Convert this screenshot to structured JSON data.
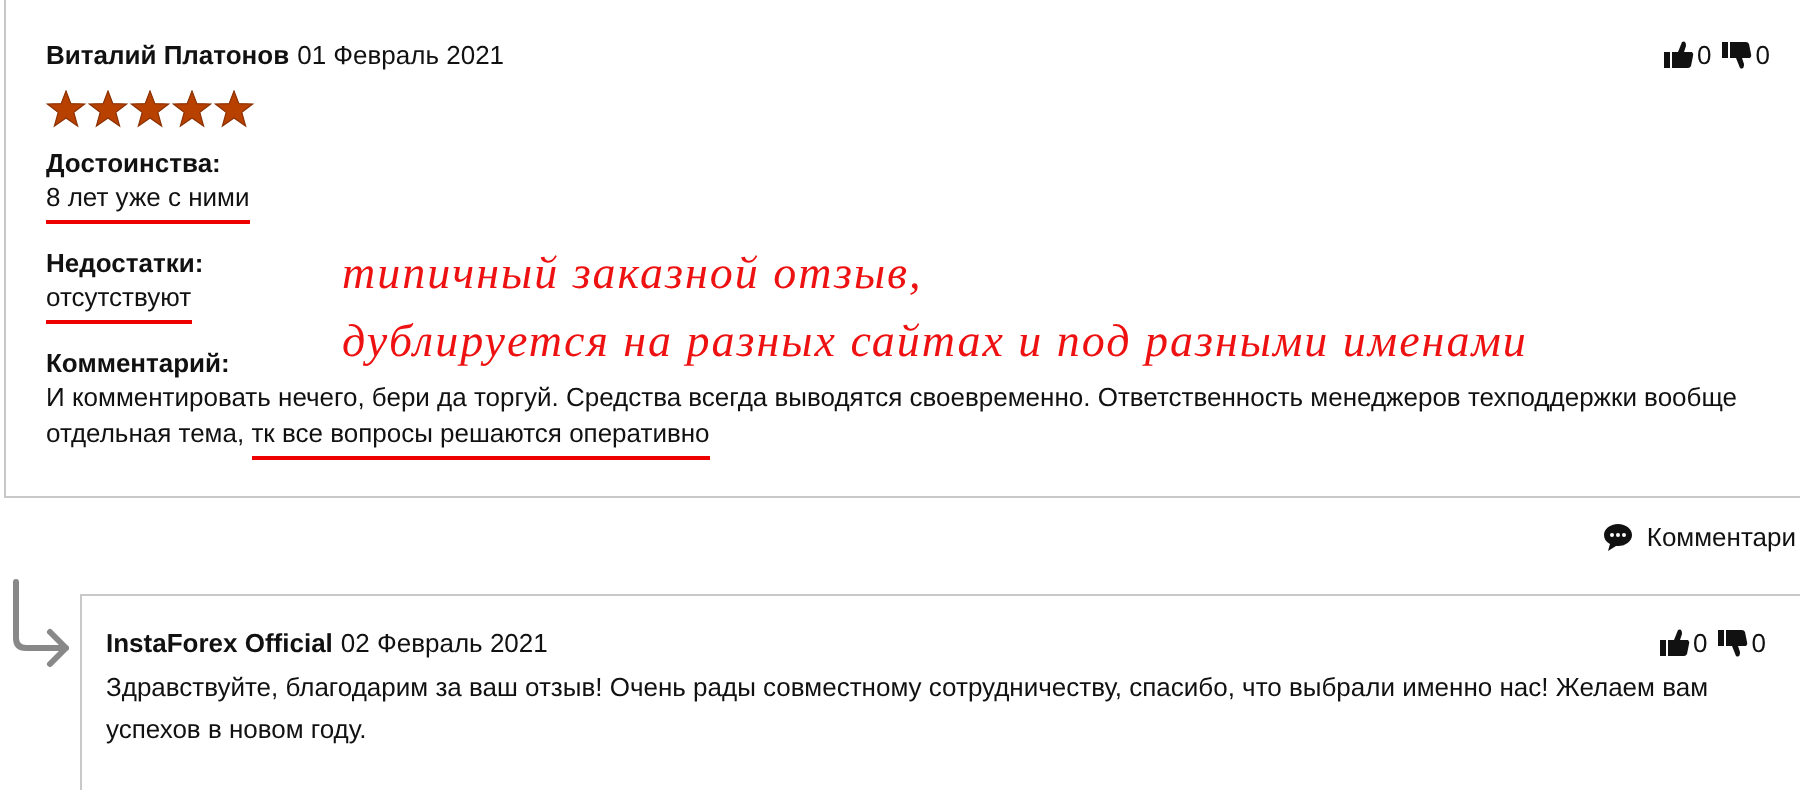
{
  "review": {
    "author": "Виталий Платонов",
    "date": "01 Февраль 2021",
    "stars": 5,
    "votes": {
      "likes": "0",
      "dislikes": "0"
    },
    "sections": [
      {
        "label": "Достоинства:",
        "parts": [
          {
            "text": "8 лет уже с ними",
            "underlined": true
          }
        ]
      },
      {
        "label": "Недостатки:",
        "parts": [
          {
            "text": "отсутствуют",
            "underlined": true
          }
        ]
      },
      {
        "label": "Комментарий:",
        "parts": [
          {
            "text": "И комментировать нечего, бери да торгуй. Средства всегда выводятся своевременно. Ответственность менеджеров техподдержки вообще отдельная тема,",
            "underlined": false
          },
          {
            "text": "тк все вопросы решаются оперативно",
            "underlined": true
          }
        ]
      }
    ],
    "comments_link": "Комментари"
  },
  "annotation": [
    "типичный заказной отзыв,",
    "дублируется на разных сайтах и под разными именами"
  ],
  "reply": {
    "author": "InstaForex Official",
    "date": "02 Февраль 2021",
    "votes": {
      "likes": "0",
      "dislikes": "0"
    },
    "text": "Здравствуйте, благодарим за ваш отзыв! Очень рады совместному сотрудничеству, спасибо, что выбрали именно нас! Желаем вам успехов в новом году."
  }
}
